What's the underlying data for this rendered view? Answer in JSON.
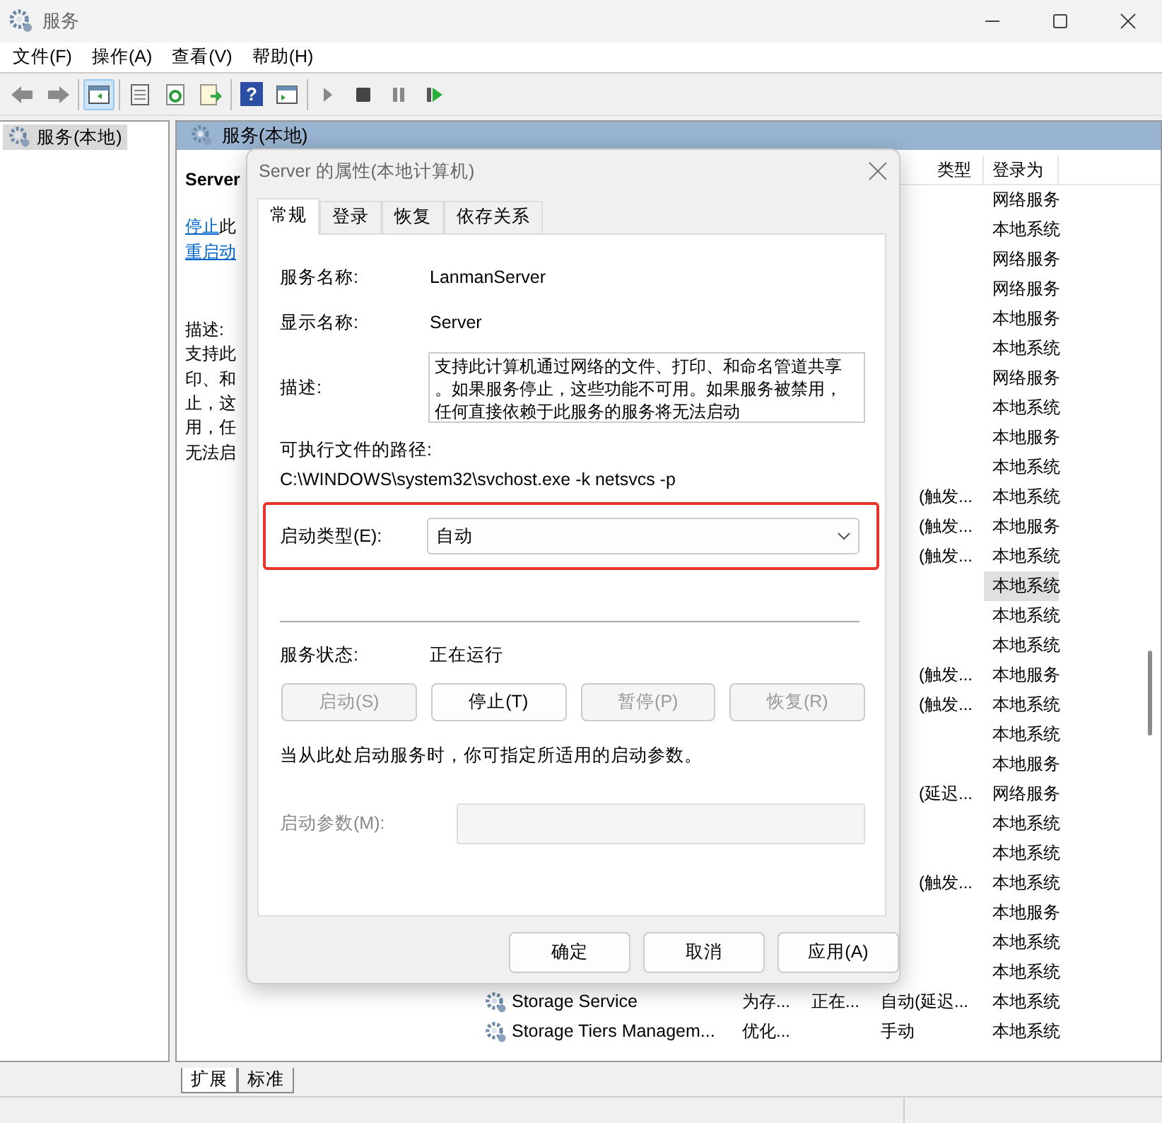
{
  "window": {
    "title": "服务"
  },
  "menu": [
    "文件(F)",
    "操作(A)",
    "查看(V)",
    "帮助(H)"
  ],
  "toolbar": [
    [
      {
        "kind": "back",
        "pressed": false
      },
      {
        "kind": "forward",
        "pressed": false
      }
    ],
    [
      {
        "kind": "tree",
        "pressed": true
      }
    ],
    [
      {
        "kind": "properties",
        "pressed": false
      },
      {
        "kind": "refresh",
        "pressed": false
      },
      {
        "kind": "export",
        "pressed": false
      }
    ],
    [
      {
        "kind": "help",
        "pressed": false,
        "glyph": "?"
      },
      {
        "kind": "view",
        "pressed": false
      }
    ],
    [
      {
        "kind": "start",
        "pressed": false
      },
      {
        "kind": "stop",
        "pressed": false
      },
      {
        "kind": "pause",
        "pressed": false
      },
      {
        "kind": "resume",
        "pressed": false
      }
    ]
  ],
  "tree": [
    {
      "label": "服务(本地)",
      "selected": true
    }
  ],
  "pane_header": "服务(本地)",
  "details": {
    "name": "Server",
    "actions": [
      {
        "link": "停止",
        "rest": "此"
      },
      {
        "link": "重启动"
      }
    ],
    "description_label": "描述:",
    "description_lines": [
      "支持此",
      "印、和",
      "止，这",
      "用，任",
      "无法启"
    ]
  },
  "list": {
    "columns": [
      {
        "label": "类型"
      },
      {
        "label": "登录为"
      }
    ],
    "rows": [
      {
        "login": "网络服务",
        "selected": false
      },
      {
        "login": "本地系统",
        "selected": false
      },
      {
        "login": "网络服务",
        "selected": false
      },
      {
        "login": "网络服务",
        "selected": false
      },
      {
        "login": "本地服务",
        "selected": false
      },
      {
        "login": "本地系统",
        "selected": false
      },
      {
        "login": "网络服务",
        "selected": false
      },
      {
        "login": "本地系统",
        "selected": false
      },
      {
        "login": "本地服务",
        "selected": false
      },
      {
        "login": "本地系统",
        "selected": false
      },
      {
        "startup": "(触发...",
        "login": "本地系统",
        "selected": false
      },
      {
        "startup": "(触发...",
        "login": "本地服务",
        "selected": false
      },
      {
        "startup": "(触发...",
        "login": "本地系统",
        "selected": false
      },
      {
        "login": "本地系统",
        "selected": true
      },
      {
        "login": "本地系统",
        "selected": false
      },
      {
        "login": "本地系统",
        "selected": false
      },
      {
        "startup": "(触发...",
        "login": "本地服务",
        "selected": false
      },
      {
        "startup": "(触发...",
        "login": "本地系统",
        "selected": false
      },
      {
        "login": "本地系统",
        "selected": false
      },
      {
        "login": "本地服务",
        "selected": false
      },
      {
        "startup": "(延迟...",
        "login": "网络服务",
        "selected": false
      },
      {
        "login": "本地系统",
        "selected": false
      },
      {
        "login": "本地系统",
        "selected": false
      },
      {
        "startup": "(触发...",
        "login": "本地系统",
        "selected": false
      },
      {
        "login": "本地服务",
        "selected": false
      },
      {
        "login": "本地系统",
        "selected": false
      },
      {
        "login": "本地系统",
        "selected": false
      },
      {
        "name": "Storage Service",
        "description": "为存...",
        "status": "正在...",
        "startup": "自动(延迟...",
        "login": "本地系统",
        "selected": false
      },
      {
        "name": "Storage Tiers Managem...",
        "description": "优化...",
        "startup": "手动",
        "login": "本地系统",
        "selected": false
      }
    ]
  },
  "dialog": {
    "title": "Server 的属性(本地计算机)",
    "tabs": [
      {
        "label": "常规",
        "selected": true
      },
      {
        "label": "登录",
        "selected": false
      },
      {
        "label": "恢复",
        "selected": false
      },
      {
        "label": "依存关系",
        "selected": false
      }
    ],
    "service_name": {
      "label": "服务名称:",
      "value": "LanmanServer"
    },
    "display_name": {
      "label": "显示名称:",
      "value": "Server"
    },
    "description": {
      "label": "描述:",
      "lines": [
        "支持此计算机通过网络的文件、打印、和命名管道共享",
        "。如果服务停止，这些功能不可用。如果服务被禁用，",
        "任何直接依赖于此服务的服务将无法启动"
      ]
    },
    "path": {
      "label": "可执行文件的路径:",
      "value": "C:\\WINDOWS\\system32\\svchost.exe -k netsvcs -p"
    },
    "startup_type": {
      "label": "启动类型(E):",
      "value": "自动",
      "highlighted": true
    },
    "status": {
      "label": "服务状态:",
      "value": "正在运行"
    },
    "service_buttons": [
      {
        "label": "启动(S)",
        "disabled": true
      },
      {
        "label": "停止(T)",
        "disabled": false
      },
      {
        "label": "暂停(P)",
        "disabled": true
      },
      {
        "label": "恢复(R)",
        "disabled": true
      }
    ],
    "hint": "当从此处启动服务时，你可指定所适用的启动参数。",
    "params": {
      "label": "启动参数(M):",
      "disabled": true
    },
    "buttons": [
      {
        "label": "确定",
        "disabled": false
      },
      {
        "label": "取消",
        "disabled": false
      },
      {
        "label": "应用(A)",
        "disabled": false
      }
    ]
  },
  "bottom_tabs": [
    {
      "label": "扩展",
      "selected": true
    },
    {
      "label": "标准",
      "selected": false
    }
  ]
}
